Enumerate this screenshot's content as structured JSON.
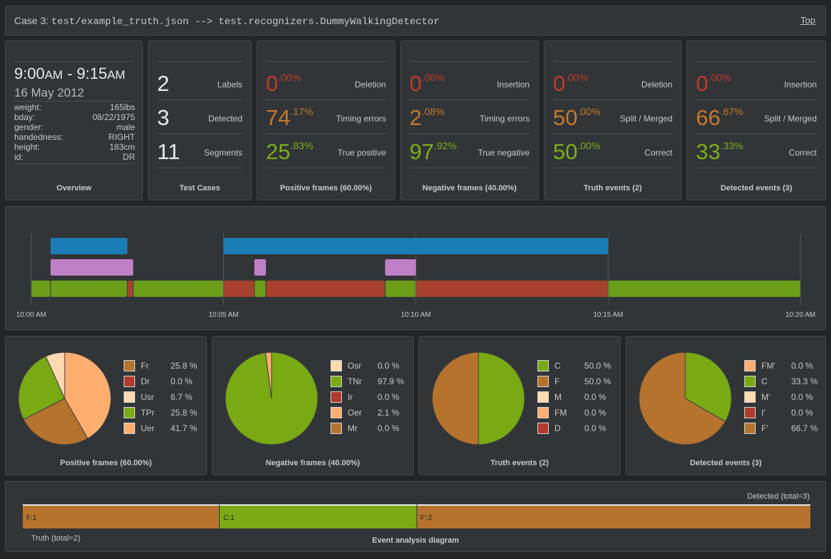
{
  "header": {
    "case_label": "Case 3:",
    "case_text": "test/example_truth.json --> test.recognizers.DummyWalkingDetector",
    "top_link": "Top"
  },
  "overview": {
    "time_start_big": "9:00",
    "time_start_ampm": "AM",
    "time_sep": " - ",
    "time_end_big": "9:15",
    "time_end_ampm": "AM",
    "date": "16 May 2012",
    "info": [
      {
        "k": "weight:",
        "v": "165lbs"
      },
      {
        "k": "bday:",
        "v": "08/22/1975"
      },
      {
        "k": "gender:",
        "v": "male"
      },
      {
        "k": "handedness:",
        "v": "RIGHT"
      },
      {
        "k": "height:",
        "v": "183cm"
      },
      {
        "k": "id:",
        "v": "DR"
      }
    ],
    "caption": "Overview"
  },
  "test_cases": {
    "caption": "Test Cases",
    "rows": [
      {
        "num": "2",
        "label": "Labels"
      },
      {
        "num": "3",
        "label": "Detected"
      },
      {
        "num": "11",
        "label": "Segments"
      }
    ]
  },
  "cards": [
    {
      "caption": "Positive frames (60.00%)",
      "rows": [
        {
          "int": "0",
          "dec": ".00%",
          "label": "Deletion",
          "color": "#c0392b"
        },
        {
          "int": "74",
          "dec": ".17%",
          "label": "Timing errors",
          "color": "#c57a2c"
        },
        {
          "int": "25",
          "dec": ".83%",
          "label": "True positive",
          "color": "#7cad1a"
        }
      ]
    },
    {
      "caption": "Negative frames (40.00%)",
      "rows": [
        {
          "int": "0",
          "dec": ".00%",
          "label": "Insertion",
          "color": "#c0392b"
        },
        {
          "int": "2",
          "dec": ".08%",
          "label": "Timing errors",
          "color": "#c57a2c"
        },
        {
          "int": "97",
          "dec": ".92%",
          "label": "True negative",
          "color": "#7cad1a"
        }
      ]
    },
    {
      "caption": "Truth events (2)",
      "rows": [
        {
          "int": "0",
          "dec": ".00%",
          "label": "Deletion",
          "color": "#c0392b"
        },
        {
          "int": "50",
          "dec": ".00%",
          "label": "Split / Merged",
          "color": "#c57a2c"
        },
        {
          "int": "50",
          "dec": ".00%",
          "label": "Correct",
          "color": "#7cad1a"
        }
      ]
    },
    {
      "caption": "Detected events (3)",
      "rows": [
        {
          "int": "0",
          "dec": ".00%",
          "label": "Insertion",
          "color": "#c0392b"
        },
        {
          "int": "66",
          "dec": ".67%",
          "label": "Split / Merged",
          "color": "#c57a2c"
        },
        {
          "int": "33",
          "dec": ".33%",
          "label": "Correct",
          "color": "#7cad1a"
        }
      ]
    }
  ],
  "timeline": {
    "ticks": [
      "10:00 AM",
      "10:05 AM",
      "10:10 AM",
      "10:15 AM",
      "10:20 AM"
    ],
    "domain_minutes": [
      0,
      20
    ],
    "truth_color": "#1a7db5",
    "detected_color": "#c080c8",
    "truth": [
      [
        0.5,
        2.5
      ],
      [
        5.0,
        15.0
      ]
    ],
    "detected": [
      [
        0.5,
        2.65
      ],
      [
        5.8,
        6.1
      ],
      [
        9.2,
        10.0
      ]
    ],
    "segments": [
      {
        "s": 0.0,
        "e": 0.5,
        "c": "#6c9e1a"
      },
      {
        "s": 0.5,
        "e": 2.5,
        "c": "#6c9e1a"
      },
      {
        "s": 2.5,
        "e": 2.65,
        "c": "#a8402e"
      },
      {
        "s": 2.65,
        "e": 5.0,
        "c": "#6c9e1a"
      },
      {
        "s": 5.0,
        "e": 5.8,
        "c": "#a8402e"
      },
      {
        "s": 5.8,
        "e": 6.1,
        "c": "#6c9e1a"
      },
      {
        "s": 6.1,
        "e": 9.2,
        "c": "#a8402e"
      },
      {
        "s": 9.2,
        "e": 10.0,
        "c": "#6c9e1a"
      },
      {
        "s": 10.0,
        "e": 15.0,
        "c": "#a8402e"
      },
      {
        "s": 15.0,
        "e": 20.0,
        "c": "#6c9e1a"
      }
    ]
  },
  "pies": [
    {
      "caption": "Positive frames (60.00%)",
      "slices": [
        {
          "name": "Fr",
          "pct": "25.8 %",
          "v": 25.8,
          "c": "#b5732e"
        },
        {
          "name": "Dr",
          "pct": "0.0 %",
          "v": 0.0,
          "c": "#b03a2e"
        },
        {
          "name": "Usr",
          "pct": "6.7 %",
          "v": 6.7,
          "c": "#ffd9b0"
        },
        {
          "name": "TPr",
          "pct": "25.8 %",
          "v": 25.8,
          "c": "#79aa14"
        },
        {
          "name": "Uer",
          "pct": "41.7 %",
          "v": 41.7,
          "c": "#ffae70"
        }
      ],
      "order": [
        4,
        0,
        1,
        3,
        2
      ]
    },
    {
      "caption": "Negative frames (40.00%)",
      "slices": [
        {
          "name": "Osr",
          "pct": "0.0 %",
          "v": 0.0,
          "c": "#ffd9b0"
        },
        {
          "name": "TNr",
          "pct": "97.9 %",
          "v": 97.9,
          "c": "#79aa14"
        },
        {
          "name": "Ir",
          "pct": "0.0 %",
          "v": 0.0,
          "c": "#b03a2e"
        },
        {
          "name": "Oer",
          "pct": "2.1 %",
          "v": 2.1,
          "c": "#ffae70"
        },
        {
          "name": "Mr",
          "pct": "0.0 %",
          "v": 0.0,
          "c": "#b5732e"
        }
      ],
      "order": [
        1,
        3,
        0,
        2,
        4
      ]
    },
    {
      "caption": "Truth events (2)",
      "slices": [
        {
          "name": "C",
          "pct": "50.0 %",
          "v": 50.0,
          "c": "#79aa14"
        },
        {
          "name": "F",
          "pct": "50.0 %",
          "v": 50.0,
          "c": "#b5732e"
        },
        {
          "name": "M",
          "pct": "0.0 %",
          "v": 0.0,
          "c": "#ffd9b0"
        },
        {
          "name": "FM",
          "pct": "0.0 %",
          "v": 0.0,
          "c": "#ffae70"
        },
        {
          "name": "D",
          "pct": "0.0 %",
          "v": 0.0,
          "c": "#b03a2e"
        }
      ],
      "order": [
        0,
        1,
        2,
        3,
        4
      ]
    },
    {
      "caption": "Detected events (3)",
      "slices": [
        {
          "name": "FM'",
          "pct": "0.0 %",
          "v": 0.0,
          "c": "#ffae70"
        },
        {
          "name": "C",
          "pct": "33.3 %",
          "v": 33.3,
          "c": "#79aa14"
        },
        {
          "name": "M'",
          "pct": "0.0 %",
          "v": 0.0,
          "c": "#ffd9b0"
        },
        {
          "name": "I'",
          "pct": "0.0 %",
          "v": 0.0,
          "c": "#b03a2e"
        },
        {
          "name": "F'",
          "pct": "66.7 %",
          "v": 66.7,
          "c": "#b5732e"
        }
      ],
      "order": [
        1,
        4,
        0,
        2,
        3
      ]
    }
  ],
  "event_diagram": {
    "caption": "Event analysis diagram",
    "detected_label": "Detected (total=3)",
    "truth_label": "Truth (total=2)",
    "segments": [
      {
        "label": "F:1",
        "color": "#b5732e",
        "share": 0.25
      },
      {
        "label": "C:1",
        "color": "#79aa14",
        "share": 0.25
      },
      {
        "label": "F':2",
        "color": "#b5732e",
        "share": 0.5
      }
    ]
  }
}
